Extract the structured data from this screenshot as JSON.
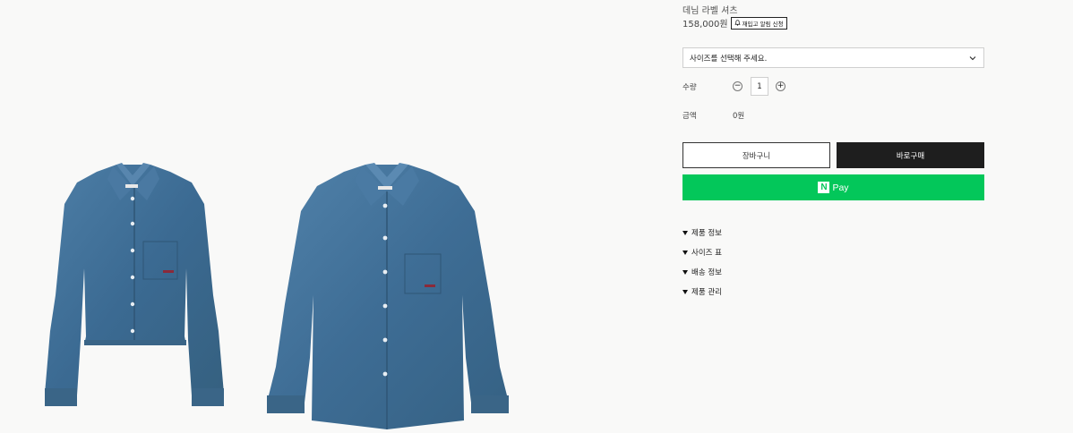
{
  "product": {
    "title": "데님 라벨 셔츠",
    "price": "158,000원",
    "restock_label": "재입고 알림 신청"
  },
  "options": {
    "size_placeholder": "사이즈를 선택해 주세요."
  },
  "quantity": {
    "label": "수량",
    "value": "1",
    "minus": "−",
    "plus": "+"
  },
  "amount": {
    "label": "금액",
    "value": "0원"
  },
  "actions": {
    "cart_label": "장바구니",
    "buy_label": "바로구매",
    "npay_logo": "N",
    "npay_label": "Pay"
  },
  "accordion": [
    {
      "label": "제품 정보"
    },
    {
      "label": "사이즈 표"
    },
    {
      "label": "배송 정보"
    },
    {
      "label": "제품 관리"
    }
  ],
  "colors": {
    "background": "#f9f9f8",
    "denim": "#3f6f96",
    "npay_green": "#03c75a",
    "buy_black": "#1e1e1e"
  }
}
